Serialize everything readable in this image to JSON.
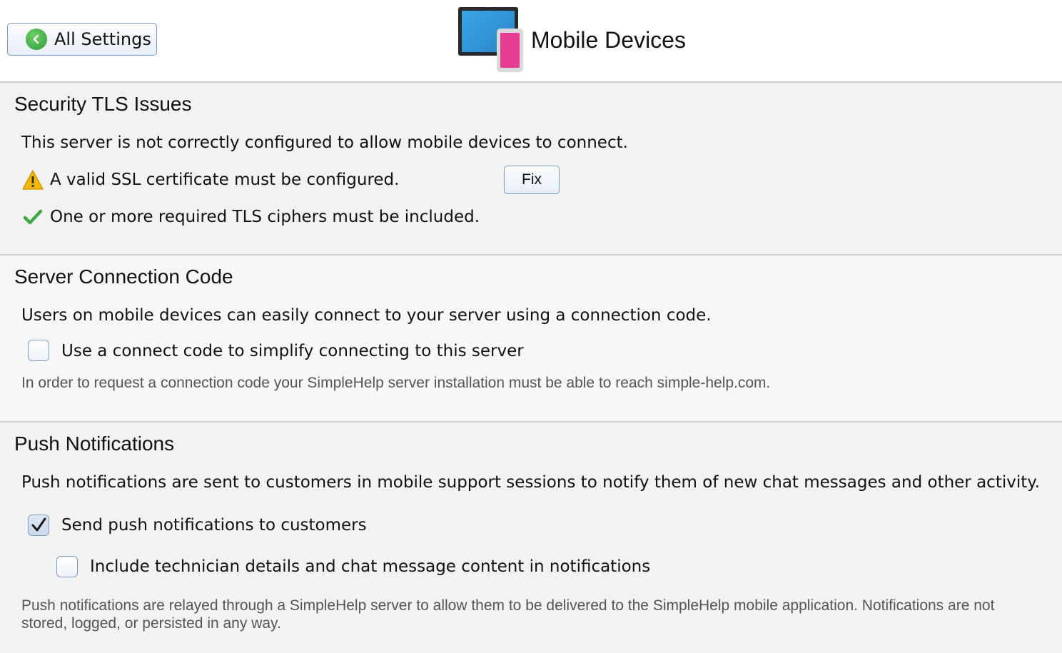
{
  "header": {
    "back_label": "All Settings",
    "title": "Mobile Devices"
  },
  "tls": {
    "title": "Security TLS Issues",
    "description": "This server is not correctly configured to allow mobile devices to connect.",
    "issues": [
      {
        "status": "warning-icon",
        "text": "A valid SSL certificate must be configured."
      },
      {
        "status": "check-icon",
        "text": "One or more required TLS ciphers must be included."
      }
    ],
    "fix_label": "Fix"
  },
  "connection_code": {
    "title": "Server Connection Code",
    "description": "Users on mobile devices can easily connect to your server using a connection code.",
    "checkbox_label": "Use a connect code to simplify connecting to this server",
    "checkbox_checked": false,
    "note": "In order to request a connection code your SimpleHelp server installation must be able to reach simple-help.com."
  },
  "push": {
    "title": "Push Notifications",
    "description": "Push notifications are sent to customers in mobile support sessions to notify them of new chat messages and other activity.",
    "send_label": "Send push notifications to customers",
    "send_checked": true,
    "include_label": "Include technician details and chat message content in notifications",
    "include_checked": false,
    "note": "Push notifications are relayed through a SimpleHelp server to allow them to be delivered to the SimpleHelp mobile application. Notifications are not stored, logged, or persisted in any way."
  },
  "colors": {
    "accent_green": "#3ea843",
    "warning_yellow": "#f5b800",
    "button_border": "#7d9cc4",
    "phone_pink": "#e83c92",
    "monitor_blue": "#2b84c8"
  }
}
